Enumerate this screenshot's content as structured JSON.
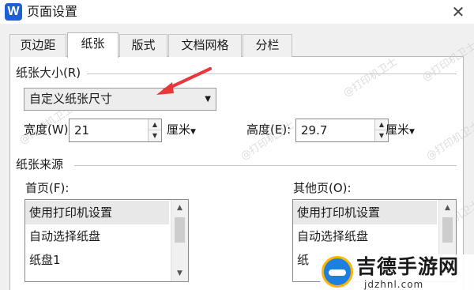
{
  "window": {
    "app_icon_letter": "W",
    "title": "页面设置",
    "close_glyph": "✕"
  },
  "tabs": [
    {
      "label": "页边距",
      "active": false
    },
    {
      "label": "纸张",
      "active": true
    },
    {
      "label": "版式",
      "active": false
    },
    {
      "label": "文档网格",
      "active": false
    },
    {
      "label": "分栏",
      "active": false
    }
  ],
  "paper_size": {
    "group_label": "纸张大小(R)",
    "select_value": "自定义纸张尺寸",
    "width_label": "宽度(W):",
    "width_value": "21",
    "width_unit": "厘米",
    "height_label": "高度(E):",
    "height_value": "29.7",
    "height_unit": "厘米"
  },
  "paper_source": {
    "group_label": "纸张来源",
    "first_page_label": "首页(F):",
    "first_page_items": [
      "使用打印机设置",
      "自动选择纸盘",
      "纸盘1"
    ],
    "other_pages_label": "其他页(O):",
    "other_pages_items": [
      "使用打印机设置",
      "自动选择纸盘",
      "纸"
    ]
  },
  "watermark_text": "@打印机卫士",
  "logo": {
    "main": "吉德手游网",
    "url": "jdzhnl.com"
  },
  "colors": {
    "annotation_arrow": "#e8383a",
    "app_icon": "#1e5fd6"
  }
}
